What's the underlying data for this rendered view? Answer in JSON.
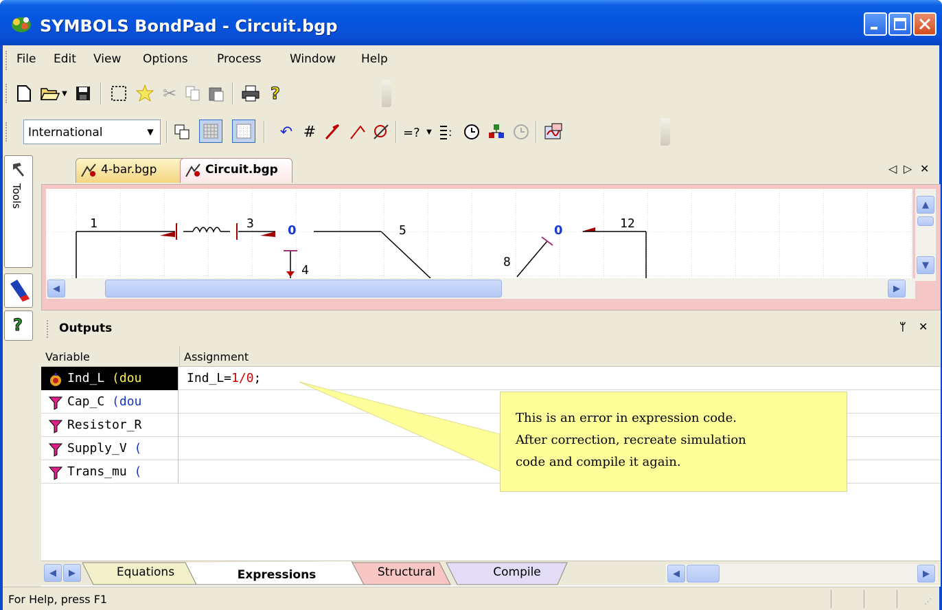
{
  "window": {
    "title": "SYMBOLS BondPad - Circuit.bgp"
  },
  "menu": [
    {
      "label": "File"
    },
    {
      "label": "Edit"
    },
    {
      "label": "View"
    },
    {
      "label": "Options"
    },
    {
      "label": "Process"
    },
    {
      "label": "Window"
    },
    {
      "label": "Help"
    }
  ],
  "toolbar2": {
    "font_combo_value": "International"
  },
  "toolstrip": {
    "tools_label": "Tools"
  },
  "doc_tabs": [
    {
      "label": "4-bar.bgp",
      "active": false
    },
    {
      "label": "Circuit.bgp",
      "active": true
    }
  ],
  "canvas": {
    "labels": [
      "1",
      "3",
      "0",
      "4",
      "5",
      "8",
      "0",
      "12"
    ]
  },
  "outputs": {
    "title": "Outputs",
    "columns": [
      "Variable",
      "Assignment"
    ],
    "rows": [
      {
        "name": "Ind_L",
        "type": "(dou",
        "assignment_var": "Ind_L=",
        "assignment_num": "1/0",
        "assignment_end": ";",
        "selected": true
      },
      {
        "name": "Cap_C",
        "type": "(dou",
        "assignment": ""
      },
      {
        "name": "Resistor_R",
        "type": "",
        "assignment": ""
      },
      {
        "name": "Supply_V",
        "type": "(",
        "assignment": ""
      },
      {
        "name": "Trans_mu",
        "type": "(",
        "assignment": ""
      }
    ]
  },
  "callout": {
    "lines": [
      "This is an error in expression code.",
      "After correction, recreate simulation",
      "code and compile it again."
    ]
  },
  "bottom_tabs": [
    {
      "label": "Equations",
      "color": "#f1f0c8"
    },
    {
      "label": "Expressions",
      "color": "#ffffff"
    },
    {
      "label": "Structural",
      "color": "#f9c6c6"
    },
    {
      "label": "Compile",
      "color": "#e3dcf7"
    }
  ],
  "status": {
    "text": "For Help, press F1"
  }
}
